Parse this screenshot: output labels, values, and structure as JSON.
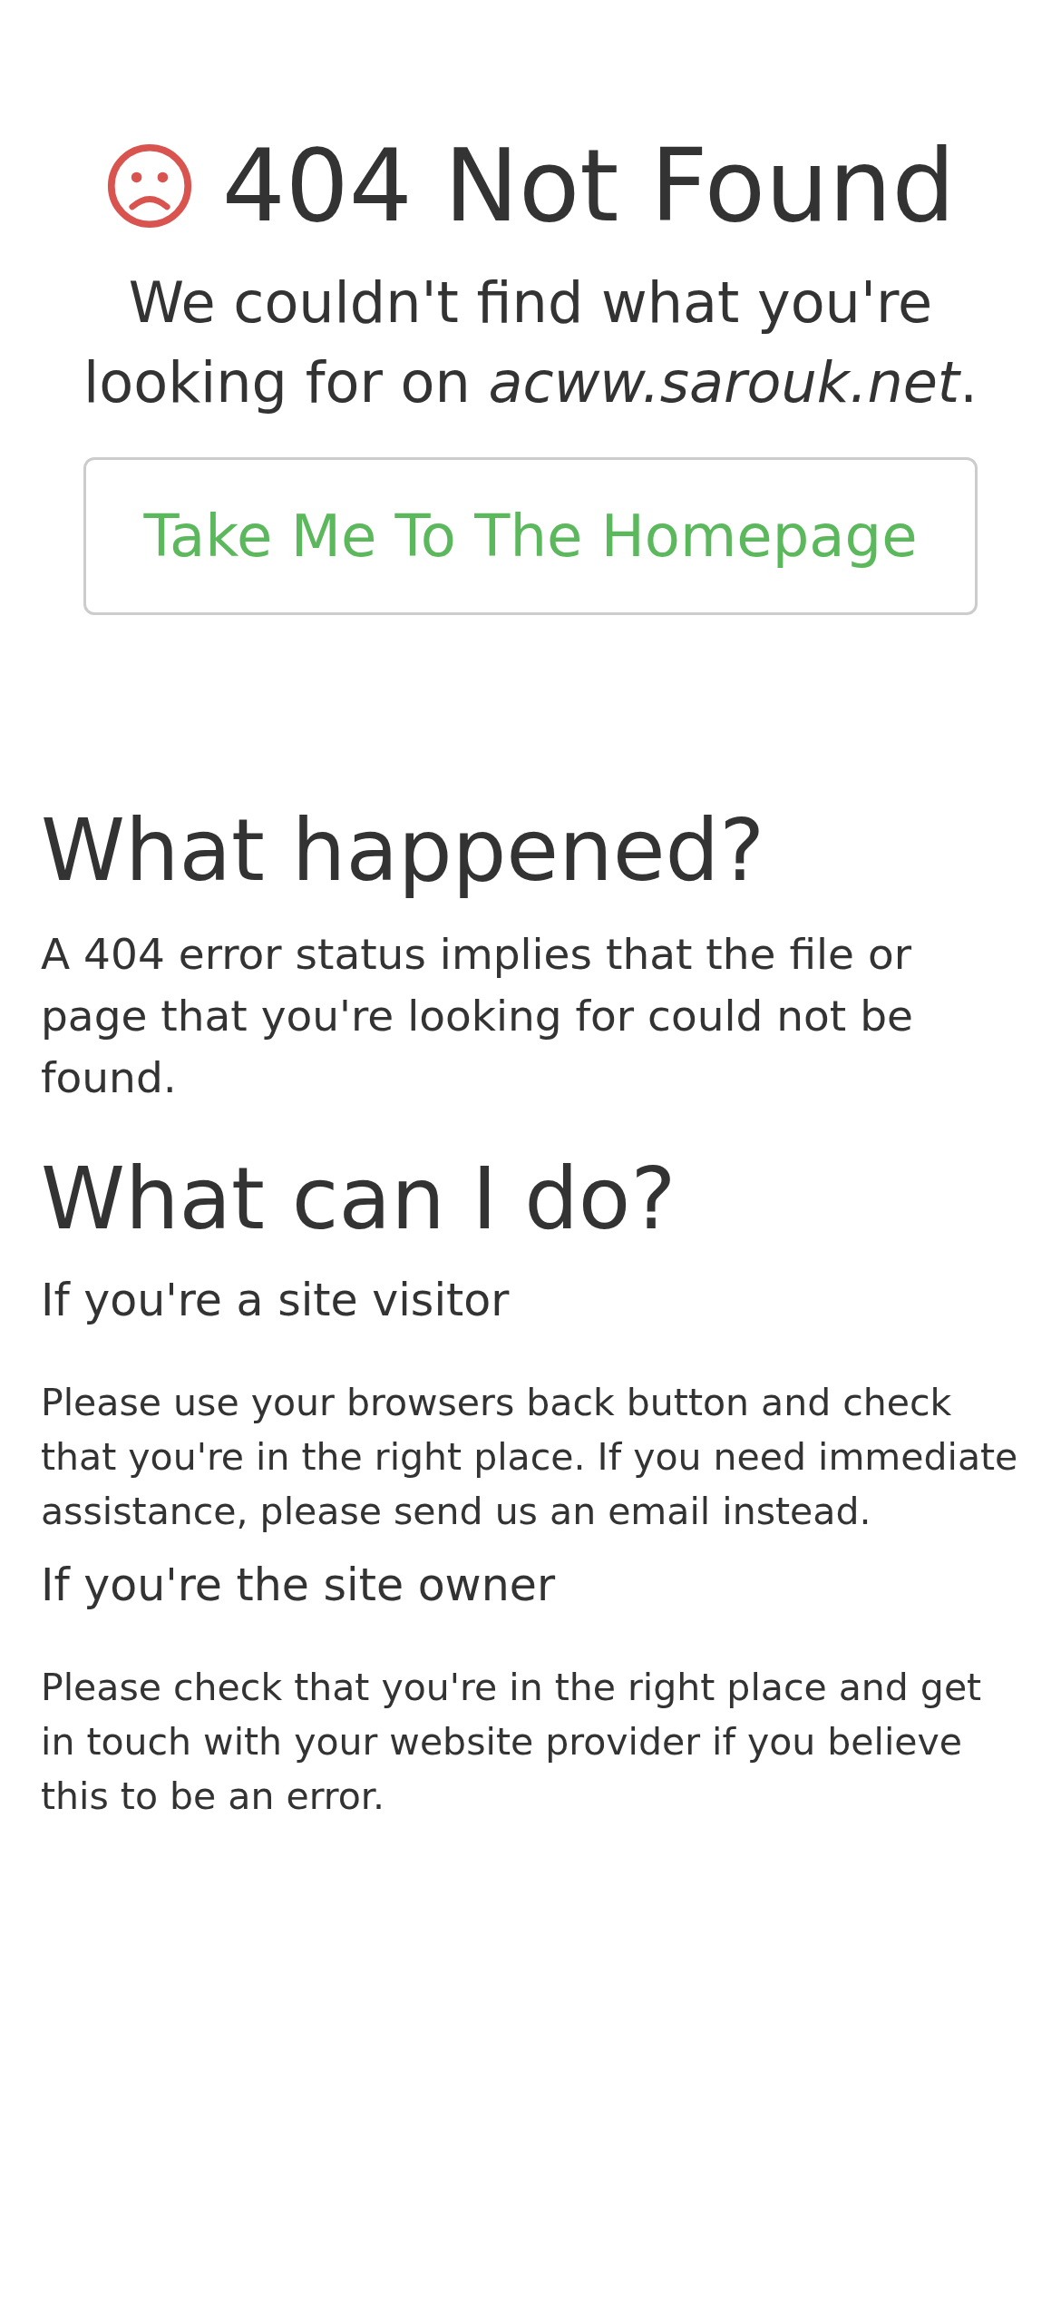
{
  "header": {
    "title": "404 Not Found",
    "subtitle": "We couldn't find what you're looking for on *acww.sarouk.net*.",
    "button": "Take Me To The Homepage"
  },
  "sections": [
    {
      "kind": "h2",
      "text": "What happened?"
    },
    {
      "kind": "lead",
      "text": "A 404 error status implies that the file or page that you're looking for could not be found."
    },
    {
      "kind": "h2",
      "text": "What can I do?"
    },
    {
      "kind": "h4",
      "text": "If you're a site visitor"
    },
    {
      "kind": "p",
      "text": "Please use your browsers back button and check that you're in the right place. If you need immediate assistance, please send us an email instead."
    },
    {
      "kind": "h4",
      "text": "If you're the site owner"
    },
    {
      "kind": "p",
      "text": "Please check that you're in the right place and get in touch with your website provider if you believe this to be an error."
    }
  ]
}
